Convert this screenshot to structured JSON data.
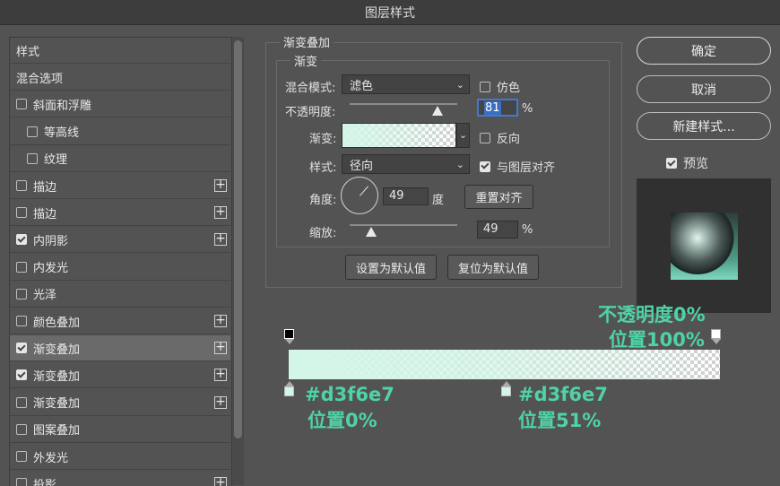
{
  "window_title": "图层样式",
  "style_list": [
    {
      "label": "样式",
      "checkbox": false,
      "checked": false,
      "plus": false,
      "indent": false,
      "selected": false
    },
    {
      "label": "混合选项",
      "checkbox": false,
      "checked": false,
      "plus": false,
      "indent": false,
      "selected": false
    },
    {
      "label": "斜面和浮雕",
      "checkbox": true,
      "checked": false,
      "plus": false,
      "indent": false,
      "selected": false
    },
    {
      "label": "等高线",
      "checkbox": true,
      "checked": false,
      "plus": false,
      "indent": true,
      "selected": false
    },
    {
      "label": "纹理",
      "checkbox": true,
      "checked": false,
      "plus": false,
      "indent": true,
      "selected": false
    },
    {
      "label": "描边",
      "checkbox": true,
      "checked": false,
      "plus": true,
      "indent": false,
      "selected": false
    },
    {
      "label": "描边",
      "checkbox": true,
      "checked": false,
      "plus": true,
      "indent": false,
      "selected": false
    },
    {
      "label": "内阴影",
      "checkbox": true,
      "checked": true,
      "plus": true,
      "indent": false,
      "selected": false
    },
    {
      "label": "内发光",
      "checkbox": true,
      "checked": false,
      "plus": false,
      "indent": false,
      "selected": false
    },
    {
      "label": "光泽",
      "checkbox": true,
      "checked": false,
      "plus": false,
      "indent": false,
      "selected": false
    },
    {
      "label": "颜色叠加",
      "checkbox": true,
      "checked": false,
      "plus": true,
      "indent": false,
      "selected": false
    },
    {
      "label": "渐变叠加",
      "checkbox": true,
      "checked": true,
      "plus": true,
      "indent": false,
      "selected": true
    },
    {
      "label": "渐变叠加",
      "checkbox": true,
      "checked": true,
      "plus": true,
      "indent": false,
      "selected": false
    },
    {
      "label": "渐变叠加",
      "checkbox": true,
      "checked": false,
      "plus": true,
      "indent": false,
      "selected": false
    },
    {
      "label": "图案叠加",
      "checkbox": true,
      "checked": false,
      "plus": false,
      "indent": false,
      "selected": false
    },
    {
      "label": "外发光",
      "checkbox": true,
      "checked": false,
      "plus": false,
      "indent": false,
      "selected": false
    },
    {
      "label": "投影",
      "checkbox": true,
      "checked": false,
      "plus": true,
      "indent": false,
      "selected": false
    }
  ],
  "panel": {
    "outer_title": "渐变叠加",
    "inner_title": "渐变",
    "blend_mode_label": "混合模式:",
    "blend_mode_value": "滤色",
    "dither_label": "仿色",
    "dither_checked": false,
    "opacity_label": "不透明度:",
    "opacity_value": "81",
    "percent": "%",
    "gradient_label": "渐变:",
    "reverse_label": "反向",
    "reverse_checked": false,
    "style_label": "样式:",
    "style_value": "径向",
    "align_label": "与图层对齐",
    "align_checked": true,
    "angle_label": "角度:",
    "angle_value": "49",
    "degree": "度",
    "reset_align": "重置对齐",
    "scale_label": "缩放:",
    "scale_value": "49",
    "set_default": "设置为默认值",
    "reset_default": "复位为默认值"
  },
  "buttons": {
    "ok": "确定",
    "cancel": "取消",
    "new_style": "新建样式...",
    "preview_label": "预览",
    "preview_checked": true
  },
  "gradient_color": "#d3f6e7",
  "annotations": {
    "opacity_stop_line1": "不透明度0%",
    "opacity_stop_line2": "位置100%",
    "stop1_color": "#d3f6e7",
    "stop1_position": "位置0%",
    "stop2_color": "#d3f6e7",
    "stop2_position": "位置51%"
  }
}
